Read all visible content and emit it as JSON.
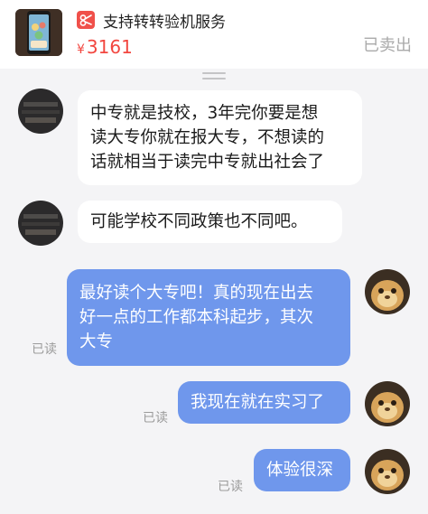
{
  "product": {
    "service_text": "支持转转验机服务",
    "price_symbol": "¥",
    "price": "3161",
    "status": "已卖出"
  },
  "messages": [
    {
      "side": "received",
      "lines": [
        "中专就是技校，3年完你要是想",
        "读大专你就在报大专，不想读的",
        "话就相当于读完中专就出社会了"
      ]
    },
    {
      "side": "received",
      "lines": [
        "可能学校不同政策也不同吧。"
      ]
    },
    {
      "side": "sent",
      "lines": [
        "最好读个大专吧！真的现在出去",
        "好一点的工作都本科起步，其次",
        "大专"
      ],
      "read_label": "已读"
    },
    {
      "side": "sent",
      "lines": [
        "我现在就在实习了"
      ],
      "read_label": "已读"
    },
    {
      "side": "sent",
      "lines": [
        "体验很深"
      ],
      "read_label": "已读"
    }
  ]
}
